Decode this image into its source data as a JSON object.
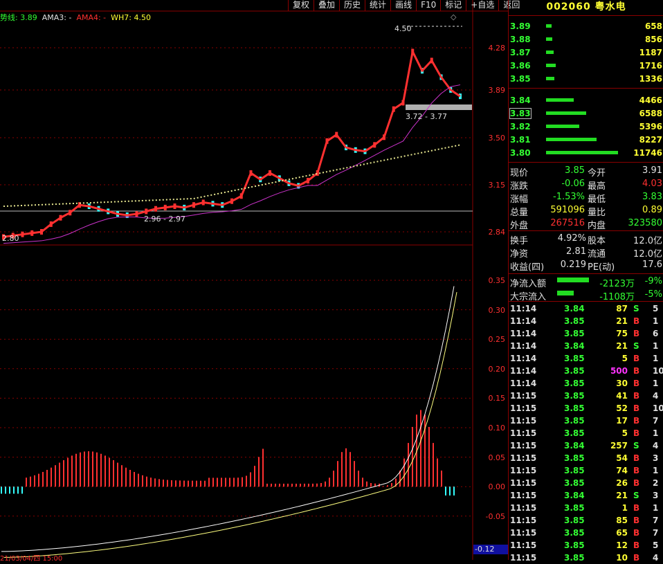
{
  "toolbar": [
    "复权",
    "叠加",
    "历史",
    "统计",
    "画线",
    "F10",
    "标记",
    "+自选",
    "返回"
  ],
  "legend": {
    "trend_label": "势线:",
    "trend_value": "3.89",
    "ama3": "AMA3: -",
    "ama4": "AMA4: -",
    "wh7_label": "WH7:",
    "wh7_value": "4.50"
  },
  "colors": {
    "up": "#ff3030",
    "down": "#33ffff",
    "dif": "#ffffff",
    "dea": "#ffff80",
    "ma": "#cc33cc"
  },
  "price_axis": [
    "4.28",
    "3.89",
    "3.50",
    "3.15",
    "2.84"
  ],
  "macd_axis": [
    "0.35",
    "0.30",
    "0.25",
    "0.20",
    "0.15",
    "0.10",
    "0.05",
    "0.00",
    "-0.05"
  ],
  "macd_current": "-0.12",
  "annotations": {
    "high_mark": "4.50",
    "high_range_label": "3.72 - 3.77",
    "low_range_label": "2.96 - 2.97",
    "low_mark": "2.80"
  },
  "time_axis_partial": "21/03/04/四 15:00",
  "stock": {
    "code": "002060",
    "name": "粤水电"
  },
  "asks": [
    {
      "price": "3.89",
      "vol": "658",
      "bar": 0.04
    },
    {
      "price": "3.88",
      "vol": "856",
      "bar": 0.05
    },
    {
      "price": "3.87",
      "vol": "1187",
      "bar": 0.07
    },
    {
      "price": "3.86",
      "vol": "1716",
      "bar": 0.1
    },
    {
      "price": "3.85",
      "vol": "1336",
      "bar": 0.08
    }
  ],
  "bids": [
    {
      "price": "3.84",
      "vol": "4466",
      "bar": 0.38
    },
    {
      "price": "3.83",
      "vol": "6588",
      "bar": 0.56
    },
    {
      "price": "3.82",
      "vol": "5396",
      "bar": 0.46
    },
    {
      "price": "3.81",
      "vol": "8227",
      "bar": 0.7
    },
    {
      "price": "3.80",
      "vol": "11746",
      "bar": 1.0
    }
  ],
  "quote": [
    {
      "l": "现价",
      "lv": "3.85",
      "lc": "g",
      "r": "今开",
      "rv": "3.91",
      "rc": "w"
    },
    {
      "l": "涨跌",
      "lv": "-0.06",
      "lc": "g",
      "r": "最高",
      "rv": "4.03",
      "rc": "r"
    },
    {
      "l": "涨幅",
      "lv": "-1.53%",
      "lc": "g",
      "r": "最低",
      "rv": "3.83",
      "rc": "g"
    },
    {
      "l": "总量",
      "lv": "591096",
      "lc": "y",
      "r": "量比",
      "rv": "0.89",
      "rc": "y"
    },
    {
      "l": "外盘",
      "lv": "267516",
      "lc": "r",
      "r": "内盘",
      "rv": "323580",
      "rc": "g"
    }
  ],
  "fundamentals": [
    {
      "l": "换手",
      "lv": "4.92%",
      "r": "股本",
      "rv": "12.0亿"
    },
    {
      "l": "净资",
      "lv": "2.81",
      "r": "流通",
      "rv": "12.0亿"
    },
    {
      "l": "收益(四)",
      "lv": "0.219",
      "r": "PE(动)",
      "rv": "17.6"
    }
  ],
  "flows": [
    {
      "l": "净流入额",
      "v": "-2123万",
      "p": "-9%",
      "bar": 0.85
    },
    {
      "l": "大宗流入",
      "v": "-1108万",
      "p": "-5%",
      "bar": 0.45
    }
  ],
  "ticks": [
    {
      "t": "11:14",
      "p": "3.84",
      "pc": "g",
      "v": "87",
      "vc": "y",
      "s": "S",
      "n": "5"
    },
    {
      "t": "11:14",
      "p": "3.85",
      "pc": "g",
      "v": "21",
      "vc": "y",
      "s": "B",
      "n": "1"
    },
    {
      "t": "11:14",
      "p": "3.85",
      "pc": "g",
      "v": "75",
      "vc": "y",
      "s": "B",
      "n": "6"
    },
    {
      "t": "11:14",
      "p": "3.84",
      "pc": "g",
      "v": "21",
      "vc": "y",
      "s": "S",
      "n": "1"
    },
    {
      "t": "11:14",
      "p": "3.85",
      "pc": "g",
      "v": "5",
      "vc": "y",
      "s": "B",
      "n": "1"
    },
    {
      "t": "11:14",
      "p": "3.85",
      "pc": "g",
      "v": "500",
      "vc": "m",
      "s": "B",
      "n": "10"
    },
    {
      "t": "11:14",
      "p": "3.85",
      "pc": "g",
      "v": "30",
      "vc": "y",
      "s": "B",
      "n": "1"
    },
    {
      "t": "11:15",
      "p": "3.85",
      "pc": "g",
      "v": "41",
      "vc": "y",
      "s": "B",
      "n": "4"
    },
    {
      "t": "11:15",
      "p": "3.85",
      "pc": "g",
      "v": "52",
      "vc": "y",
      "s": "B",
      "n": "10"
    },
    {
      "t": "11:15",
      "p": "3.85",
      "pc": "g",
      "v": "17",
      "vc": "y",
      "s": "B",
      "n": "7"
    },
    {
      "t": "11:15",
      "p": "3.85",
      "pc": "g",
      "v": "5",
      "vc": "y",
      "s": "B",
      "n": "1"
    },
    {
      "t": "11:15",
      "p": "3.84",
      "pc": "g",
      "v": "257",
      "vc": "y",
      "s": "S",
      "n": "4"
    },
    {
      "t": "11:15",
      "p": "3.85",
      "pc": "g",
      "v": "54",
      "vc": "y",
      "s": "B",
      "n": "3"
    },
    {
      "t": "11:15",
      "p": "3.85",
      "pc": "g",
      "v": "74",
      "vc": "y",
      "s": "B",
      "n": "1"
    },
    {
      "t": "11:15",
      "p": "3.85",
      "pc": "g",
      "v": "26",
      "vc": "y",
      "s": "B",
      "n": "2"
    },
    {
      "t": "11:15",
      "p": "3.84",
      "pc": "g",
      "v": "21",
      "vc": "y",
      "s": "S",
      "n": "3"
    },
    {
      "t": "11:15",
      "p": "3.85",
      "pc": "g",
      "v": "1",
      "vc": "y",
      "s": "B",
      "n": "1"
    },
    {
      "t": "11:15",
      "p": "3.85",
      "pc": "g",
      "v": "85",
      "vc": "y",
      "s": "B",
      "n": "7"
    },
    {
      "t": "11:15",
      "p": "3.85",
      "pc": "g",
      "v": "65",
      "vc": "y",
      "s": "B",
      "n": "7"
    },
    {
      "t": "11:15",
      "p": "3.85",
      "pc": "g",
      "v": "12",
      "vc": "y",
      "s": "B",
      "n": "5"
    },
    {
      "t": "11:15",
      "p": "3.85",
      "pc": "g",
      "v": "10",
      "vc": "y",
      "s": "B",
      "n": "4"
    }
  ]
}
